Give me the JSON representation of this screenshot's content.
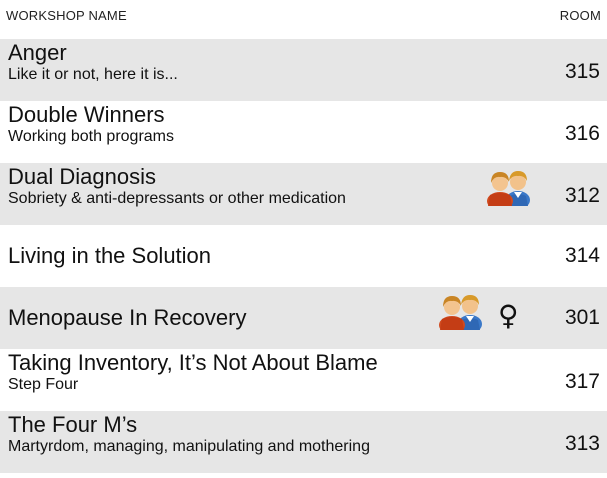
{
  "header": {
    "workshop_label": "WORKSHOP NAME",
    "room_label": "ROOM"
  },
  "workshops": [
    {
      "title": "Anger",
      "subtitle": "Like it or not, here it is...",
      "room": "315",
      "icons": []
    },
    {
      "title": "Double Winners",
      "subtitle": "Working both programs",
      "room": "316",
      "icons": []
    },
    {
      "title": "Dual Diagnosis",
      "subtitle": "Sobriety & anti-depressants or other medication",
      "room": "312",
      "icons": [
        "people-icon"
      ]
    },
    {
      "title": "Living in the Solution",
      "subtitle": "",
      "room": "314",
      "icons": []
    },
    {
      "title": "Menopause In Recovery",
      "subtitle": "",
      "room": "301",
      "icons": [
        "people-icon",
        "female-icon"
      ]
    },
    {
      "title": "Taking Inventory, It’s Not About Blame",
      "subtitle": "Step Four",
      "room": "317",
      "icons": []
    },
    {
      "title": "The Four M’s",
      "subtitle": "Martyrdom, managing, manipulating and mothering",
      "room": "313",
      "icons": []
    }
  ],
  "colors": {
    "row_shade": "#e6e6e6",
    "text": "#111111"
  },
  "icons": {
    "female_symbol": "♀"
  }
}
